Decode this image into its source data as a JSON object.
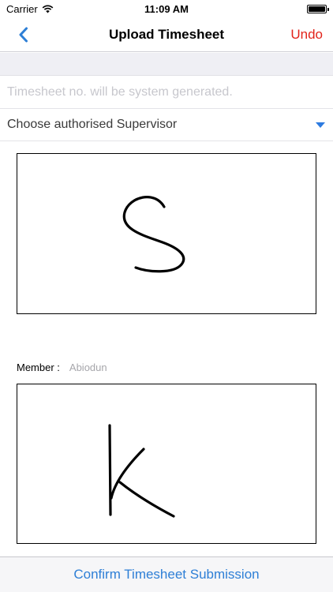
{
  "status_bar": {
    "carrier": "Carrier",
    "time": "11:09 AM",
    "battery_level": 1.0
  },
  "nav": {
    "title": "Upload Timesheet",
    "undo_label": "Undo",
    "back_icon": "chevron-left-icon"
  },
  "timesheet": {
    "placeholder": "Timesheet no. will be system generated.",
    "value": ""
  },
  "supervisor": {
    "label": "Choose authorised Supervisor",
    "caret_icon": "caret-down-icon"
  },
  "member": {
    "label": "Member :",
    "value": "Abiodun"
  },
  "footer": {
    "confirm_label": "Confirm Timesheet Submission"
  },
  "colors": {
    "accent": "#2e7fd6",
    "undo": "#e2231a",
    "placeholder": "#c7c7cd",
    "band": "#efeff4"
  }
}
